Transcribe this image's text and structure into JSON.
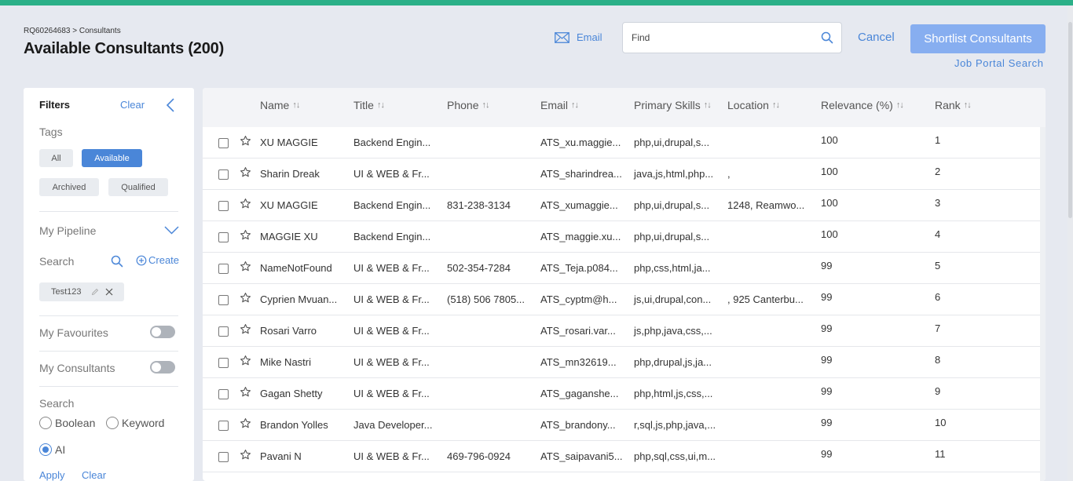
{
  "header": {
    "breadcrumb": "RQ60264683 > Consultants",
    "title": "Available Consultants (200)",
    "email_label": "Email",
    "find_placeholder": "Find",
    "cancel_label": "Cancel",
    "shortlist_label": "Shortlist Consultants",
    "portal_label": "Job Portal Search"
  },
  "sidebar": {
    "title": "Filters",
    "clear_label": "Clear",
    "tags_label": "Tags",
    "tags": [
      {
        "label": "All",
        "active": false
      },
      {
        "label": "Available",
        "active": true
      },
      {
        "label": "Archived",
        "active": false
      },
      {
        "label": "Qualified",
        "active": false
      }
    ],
    "pipeline_label": "My Pipeline",
    "search_label": "Search",
    "create_label": "Create",
    "saved_search": "Test123",
    "favourites_label": "My Favourites",
    "consultants_label": "My Consultants",
    "search2_label": "Search",
    "search_modes": [
      {
        "label": "Boolean",
        "checked": false
      },
      {
        "label": "Keyword",
        "checked": false
      },
      {
        "label": "AI",
        "checked": true
      }
    ],
    "apply_label": "Apply",
    "clear2_label": "Clear"
  },
  "table": {
    "columns": [
      "Name",
      "Title",
      "Phone",
      "Email",
      "Primary Skills",
      "Location",
      "Relevance (%)",
      "Rank"
    ],
    "rows": [
      [
        "XU MAGGIE",
        "Backend Engin...",
        "",
        "ATS_xu.maggie...",
        "php,ui,drupal,s...",
        "",
        "100",
        "1"
      ],
      [
        "Sharin Dreak",
        "UI & WEB & Fr...",
        "",
        "ATS_sharindrea...",
        "java,js,html,php...",
        ",",
        "100",
        "2"
      ],
      [
        "XU MAGGIE",
        "Backend Engin...",
        "831-238-3134",
        "ATS_xumaggie...",
        "php,ui,drupal,s...",
        "1248, Reamwo...",
        "100",
        "3"
      ],
      [
        "MAGGIE XU",
        "Backend Engin...",
        "",
        "ATS_maggie.xu...",
        "php,ui,drupal,s...",
        "",
        "100",
        "4"
      ],
      [
        "NameNotFound",
        "UI & WEB & Fr...",
        "502-354-7284",
        "ATS_Teja.p084...",
        "php,css,html,ja...",
        "",
        "99",
        "5"
      ],
      [
        "Cyprien Mvuan...",
        "UI & WEB & Fr...",
        "(518) 506 7805...",
        "ATS_cyptm@h...",
        "js,ui,drupal,con...",
        ", 925 Canterbu...",
        "99",
        "6"
      ],
      [
        "Rosari Varro",
        "UI & WEB & Fr...",
        "",
        "ATS_rosari.var...",
        "js,php,java,css,...",
        "",
        "99",
        "7"
      ],
      [
        "Mike Nastri",
        "UI & WEB & Fr...",
        "",
        "ATS_mn32619...",
        "php,drupal,js,ja...",
        "",
        "99",
        "8"
      ],
      [
        "Gagan Shetty",
        "UI & WEB & Fr...",
        "",
        "ATS_gaganshe...",
        "php,html,js,css,...",
        "",
        "99",
        "9"
      ],
      [
        "Brandon Yolles",
        "Java Developer...",
        "",
        "ATS_brandony...",
        "r,sql,js,php,java,...",
        "",
        "99",
        "10"
      ],
      [
        "Pavani N",
        "UI & WEB & Fr...",
        "469-796-0924",
        "ATS_saipavani5...",
        "php,sql,css,ui,m...",
        "",
        "99",
        "11"
      ]
    ]
  },
  "colors": {
    "accent": "#4a86d8",
    "topbar": "#2bb088",
    "primary_button": "#87aef0"
  }
}
